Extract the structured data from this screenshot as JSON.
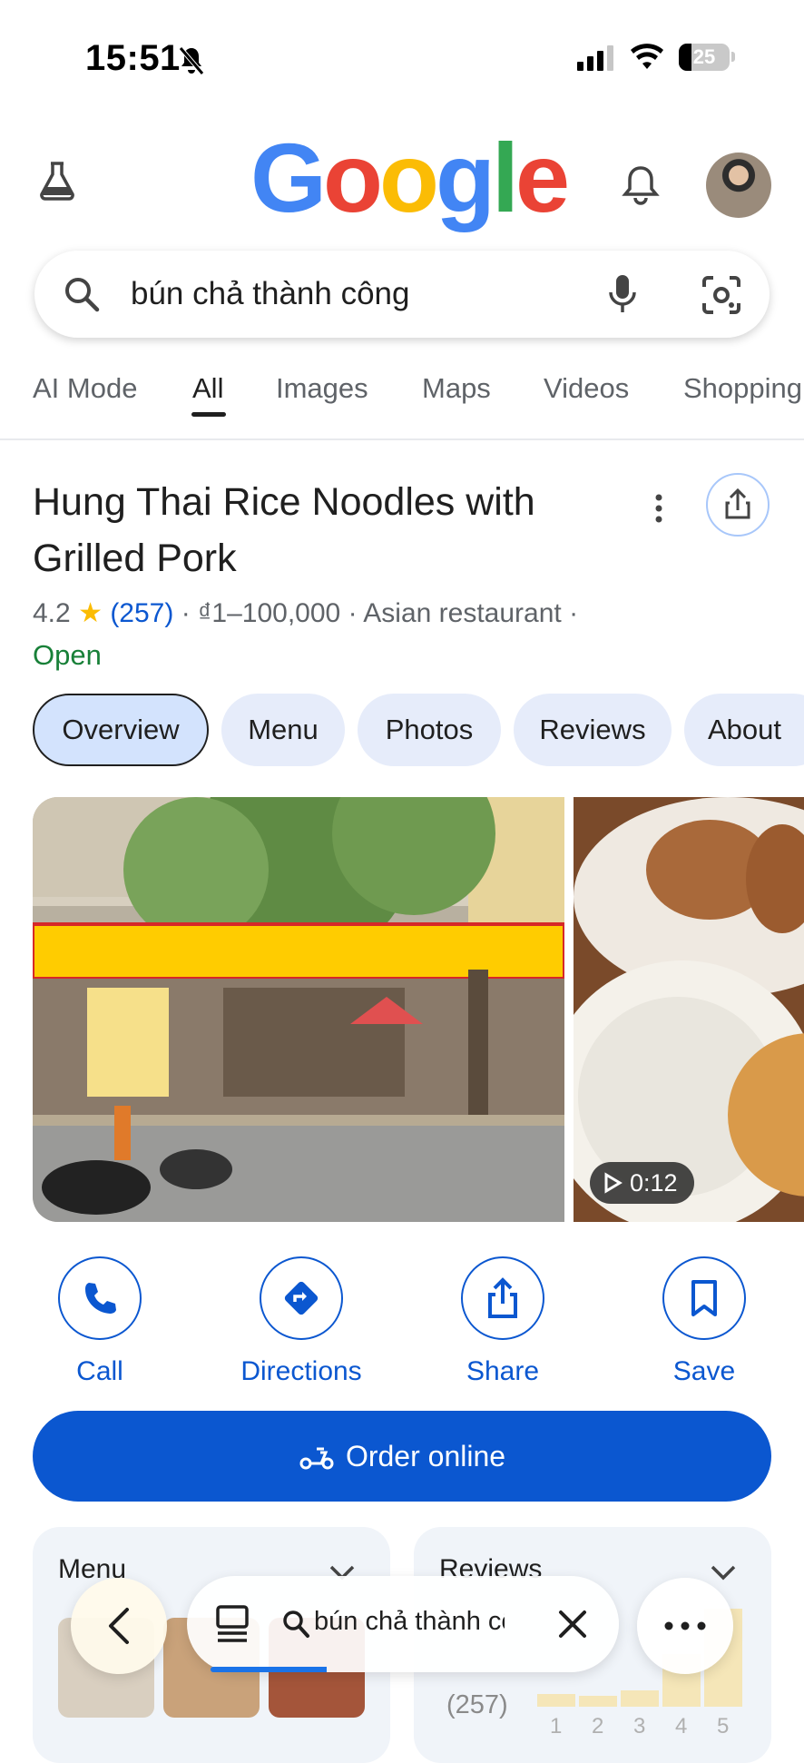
{
  "status_bar": {
    "time": "15:51",
    "battery": "25"
  },
  "header": {
    "logo": [
      "G",
      "o",
      "o",
      "g",
      "l",
      "e"
    ]
  },
  "search": {
    "query": "bún chả thành công"
  },
  "tabs": [
    "AI Mode",
    "All",
    "Images",
    "Maps",
    "Videos",
    "Shopping"
  ],
  "place": {
    "name": "Hung Thai Rice Noodles with Grilled Pork",
    "rating": "4.2",
    "reviews_count": "(257)",
    "price": "₫1–100,000",
    "category": "Asian restaurant",
    "status": "Open"
  },
  "chips": [
    "Overview",
    "Menu",
    "Photos",
    "Reviews",
    "About"
  ],
  "video_duration": "0:12",
  "actions": [
    "Call",
    "Directions",
    "Share",
    "Save"
  ],
  "order_label": "Order online",
  "cards": {
    "menu_title": "Menu",
    "reviews_title": "Reviews",
    "reviews_count": "(257)",
    "histogram_labels": [
      "1",
      "2",
      "3",
      "4",
      "5"
    ]
  },
  "bottom_bar": {
    "url_text": "bún chả thành cô"
  },
  "colors": {
    "accent": "#0b57d0",
    "open": "#188038",
    "star": "#fbbc04"
  }
}
